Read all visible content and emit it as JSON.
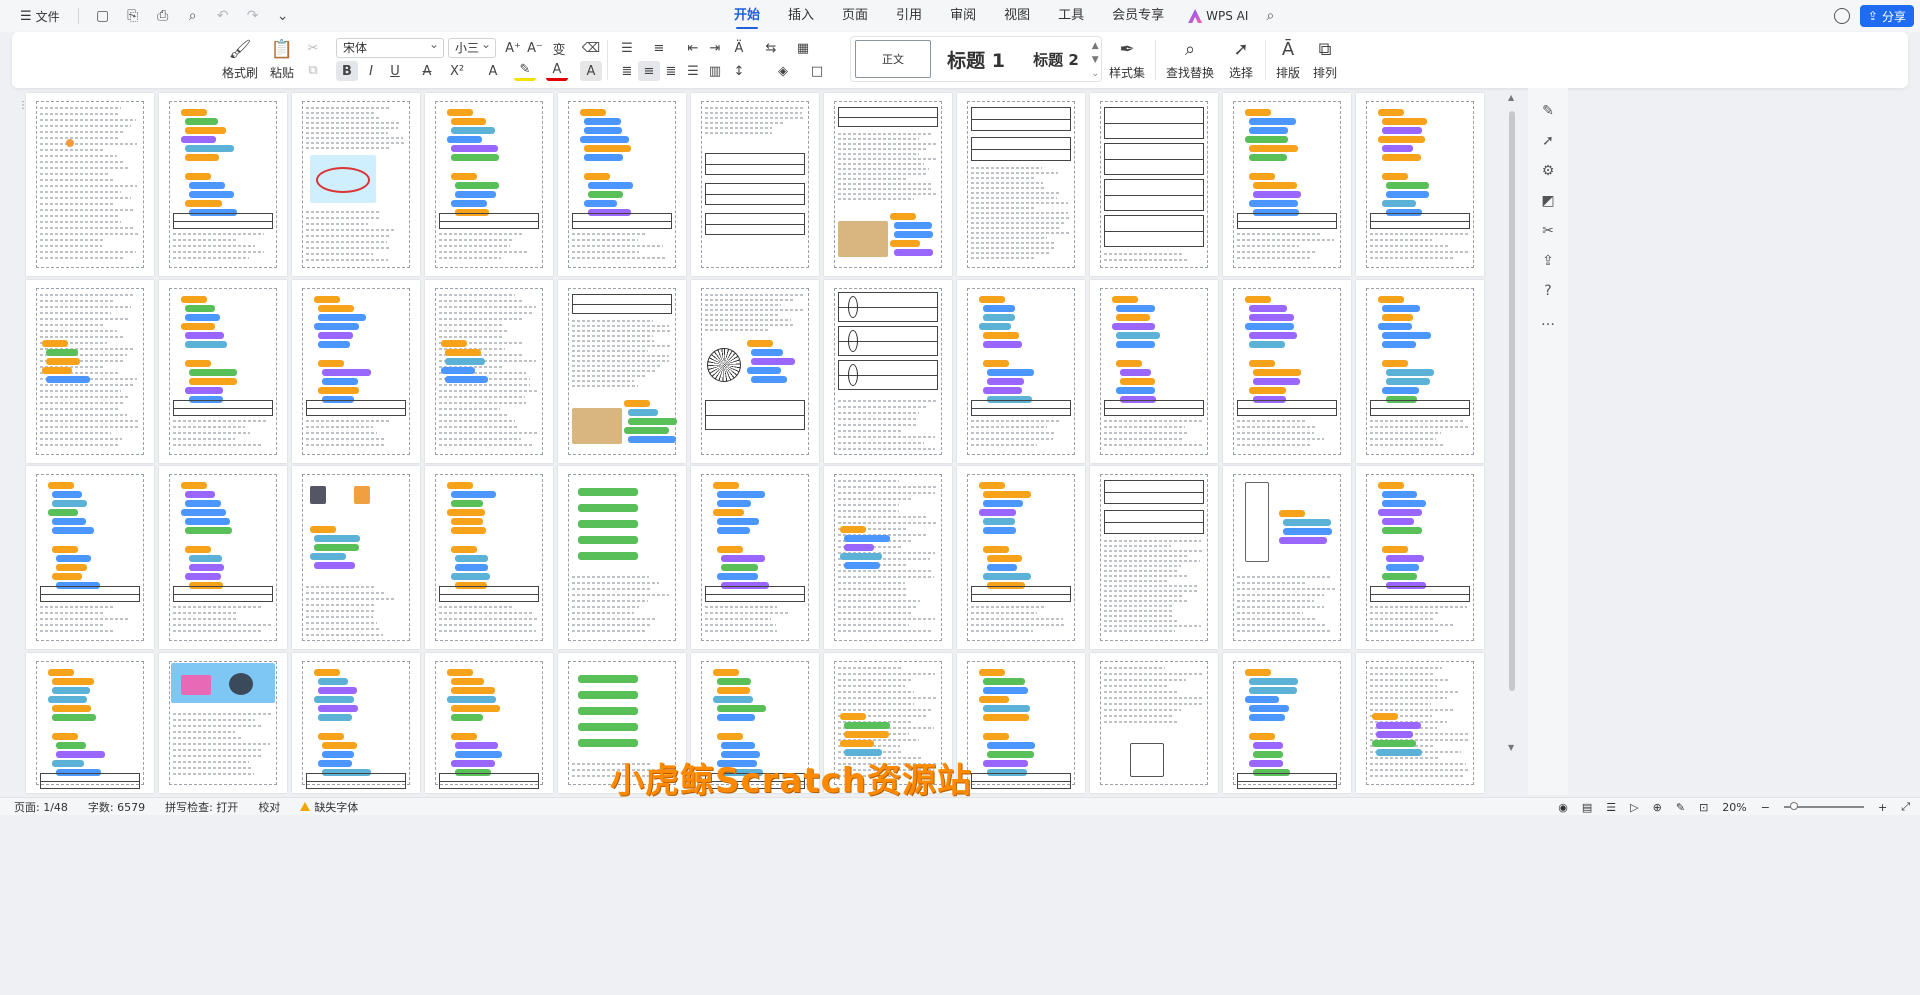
{
  "menubar": {
    "file_label": "文件",
    "tabs": [
      {
        "label": "开始",
        "active": true
      },
      {
        "label": "插入"
      },
      {
        "label": "页面"
      },
      {
        "label": "引用"
      },
      {
        "label": "审阅"
      },
      {
        "label": "视图"
      },
      {
        "label": "工具"
      },
      {
        "label": "会员专享"
      }
    ],
    "wps_ai_label": "WPS AI",
    "share_label": "分享"
  },
  "ribbon": {
    "format_painter": "格式刷",
    "paste": "粘贴",
    "font_name": "宋体",
    "font_size": "小三",
    "styles": {
      "normal": "正文",
      "heading1": "标题 1",
      "heading2": "标题 2"
    },
    "style_set": "样式集",
    "find_replace": "查找替换",
    "select": "选择",
    "typeset": "排版",
    "arrange": "排列"
  },
  "watermark": "小虎鲸Scratch资源站",
  "statusbar": {
    "page": "页面: 1/48",
    "word_count": "字数: 6579",
    "spell_check": "拼写检查: 打开",
    "proofread": "校对",
    "missing_font": "缺失字体",
    "zoom": "20%"
  },
  "colors": {
    "accent": "#1f5fd9",
    "share": "#1f6cf2",
    "watermark": "#ff8a00"
  }
}
